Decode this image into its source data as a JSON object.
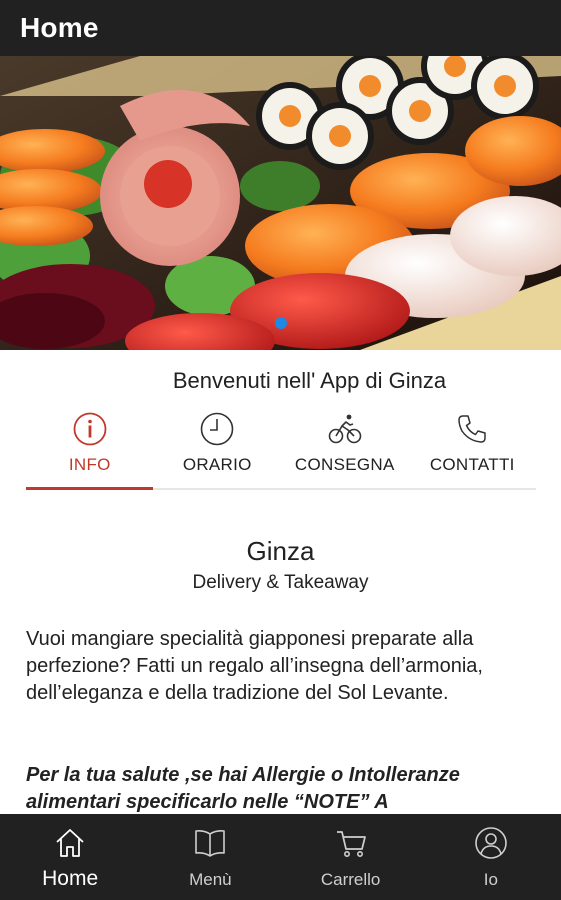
{
  "appbar": {
    "title": "Home"
  },
  "hero": {
    "image": "sushi-platter",
    "carousel_active_index": 0,
    "carousel_dot_color": "#1e88e5"
  },
  "welcome": "Benvenuti nell' App di Ginza",
  "tabs": [
    {
      "label": "INFO",
      "icon": "info-icon",
      "active": true
    },
    {
      "label": "ORARIO",
      "icon": "clock-icon",
      "active": false
    },
    {
      "label": "CONSEGNA",
      "icon": "bicycle-icon",
      "active": false
    },
    {
      "label": "CONTATTI",
      "icon": "phone-icon",
      "active": false
    }
  ],
  "content": {
    "title": "Ginza",
    "subtitle": "Delivery & Takeaway",
    "description": "Vuoi mangiare specialità giapponesi preparate alla perfezione? Fatti un regalo all’insegna dell’armonia, dell’eleganza e della tradizione del Sol Levante.",
    "note": "Per la tua salute ,se hai Allergie o Intolleranze alimentari specificarlo nelle “NOTE” A"
  },
  "bottom_nav": [
    {
      "label": "Home",
      "icon": "home-icon",
      "active": true
    },
    {
      "label": "Menù",
      "icon": "book-icon",
      "active": false
    },
    {
      "label": "Carrello",
      "icon": "cart-icon",
      "active": false
    },
    {
      "label": "Io",
      "icon": "user-icon",
      "active": false
    }
  ],
  "colors": {
    "bar_background": "#212121",
    "accent": "#c0392b",
    "text": "#222222"
  }
}
